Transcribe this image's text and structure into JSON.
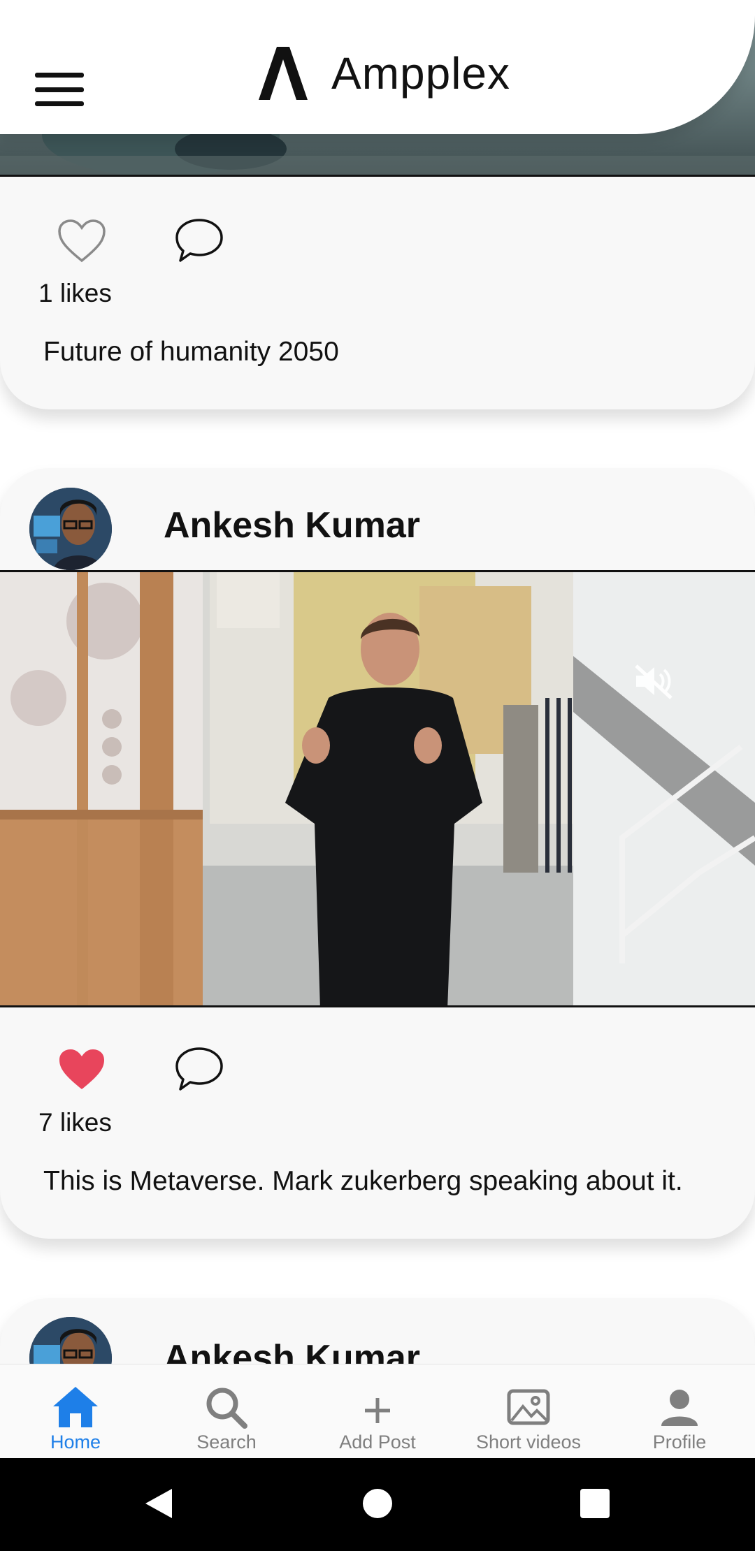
{
  "app": {
    "name": "Ampplex"
  },
  "posts": [
    {
      "author": "",
      "liked": false,
      "likes_text": "1 likes",
      "caption": "Future of humanity 2050"
    },
    {
      "author": "Ankesh Kumar",
      "liked": true,
      "likes_text": "7 likes",
      "caption": "This is Metaverse. Mark zukerberg speaking about it.",
      "video_muted": true
    },
    {
      "author": "Ankesh Kumar"
    }
  ],
  "nav": {
    "active": "home",
    "items": [
      {
        "key": "home",
        "label": "Home",
        "icon": "home-icon"
      },
      {
        "key": "search",
        "label": "Search",
        "icon": "search-icon"
      },
      {
        "key": "add_post",
        "label": "Add Post",
        "icon": "plus-icon"
      },
      {
        "key": "short_videos",
        "label": "Short videos",
        "icon": "image-icon"
      },
      {
        "key": "profile",
        "label": "Profile",
        "icon": "person-icon"
      }
    ]
  },
  "colors": {
    "accent": "#1e7fe8",
    "like_active": "#e8455c",
    "nav_inactive": "#7f7f7f"
  }
}
